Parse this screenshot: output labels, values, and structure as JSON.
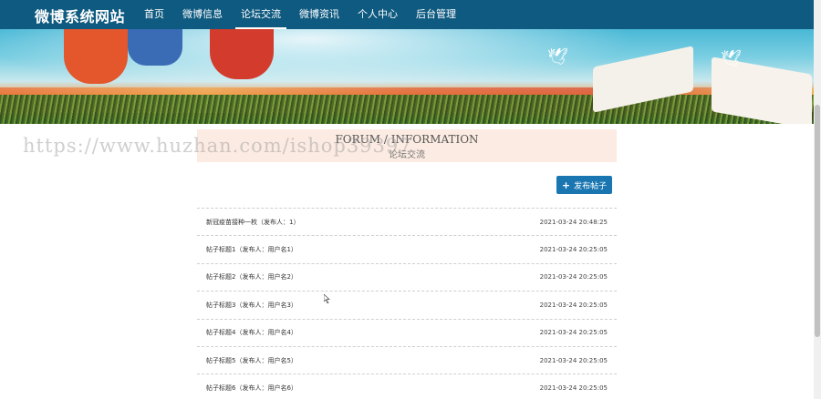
{
  "navbar": {
    "brand": "微博系统网站",
    "items": [
      {
        "label": "首页",
        "active": false
      },
      {
        "label": "微博信息",
        "active": false
      },
      {
        "label": "论坛交流",
        "active": true
      },
      {
        "label": "微博资讯",
        "active": false
      },
      {
        "label": "个人中心",
        "active": false
      },
      {
        "label": "后台管理",
        "active": false
      }
    ]
  },
  "section": {
    "title_en": "FORUM / INFORMATION",
    "title_zh": "论坛交流"
  },
  "watermark": "https://www.huzhan.com/ishop39397",
  "actions": {
    "post_label": "发布帖子",
    "post_icon": "plus-icon"
  },
  "posts": [
    {
      "title": "新冠疫苗接种一枚（发布人：1）",
      "date": "2021-03-24 20:48:25"
    },
    {
      "title": "帖子标题1（发布人：用户名1）",
      "date": "2021-03-24 20:25:05"
    },
    {
      "title": "帖子标题2（发布人：用户名2）",
      "date": "2021-03-24 20:25:05"
    },
    {
      "title": "帖子标题3（发布人：用户名3）",
      "date": "2021-03-24 20:25:05"
    },
    {
      "title": "帖子标题4（发布人：用户名4）",
      "date": "2021-03-24 20:25:05"
    },
    {
      "title": "帖子标题5（发布人：用户名5）",
      "date": "2021-03-24 20:25:05"
    },
    {
      "title": "帖子标题6（发布人：用户名6）",
      "date": "2021-03-24 20:25:05"
    }
  ],
  "colors": {
    "navbar": "#0f5a80",
    "button": "#1a76b1",
    "title_bg": "#fcebe2"
  }
}
